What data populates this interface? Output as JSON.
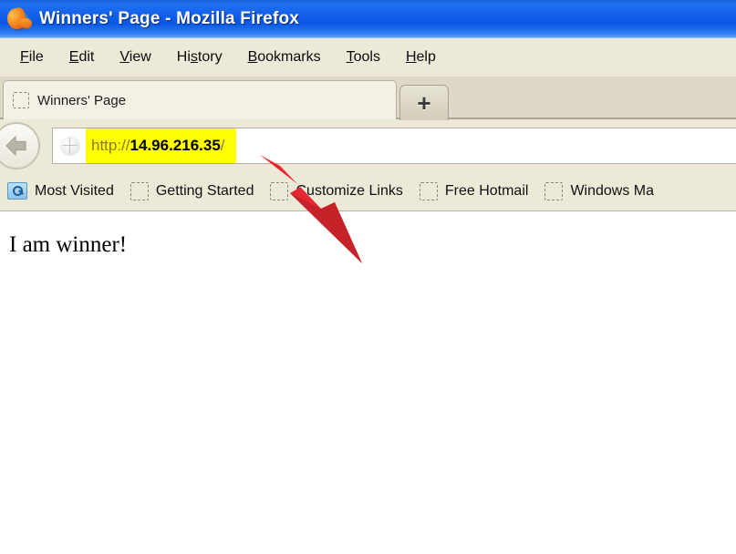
{
  "window": {
    "title": "Winners' Page - Mozilla Firefox",
    "logo_icon": "firefox-logo-icon"
  },
  "menu": {
    "items": [
      {
        "label": "File",
        "accel": "F"
      },
      {
        "label": "Edit",
        "accel": "E"
      },
      {
        "label": "View",
        "accel": "V"
      },
      {
        "label": "History",
        "accel": "s"
      },
      {
        "label": "Bookmarks",
        "accel": "B"
      },
      {
        "label": "Tools",
        "accel": "T"
      },
      {
        "label": "Help",
        "accel": "H"
      }
    ]
  },
  "tabs": {
    "active": {
      "label": "Winners' Page",
      "favicon_icon": "blank-favicon-icon"
    },
    "new_tab_label": "+"
  },
  "navigation": {
    "back_icon": "back-arrow-icon",
    "site_favicon_icon": "globe-icon",
    "url": {
      "scheme": "http://",
      "host": "14.96.216.35",
      "path": "/",
      "full": "http://14.96.216.35/",
      "highlight_color": "#ffff00"
    }
  },
  "bookmarks": {
    "items": [
      {
        "label": "Most Visited",
        "icon": "most-visited-folder-icon"
      },
      {
        "label": "Getting Started",
        "icon": "blank-favicon-icon"
      },
      {
        "label": "Customize Links",
        "icon": "blank-favicon-icon"
      },
      {
        "label": "Free Hotmail",
        "icon": "blank-favicon-icon"
      },
      {
        "label": "Windows Ma",
        "icon": "blank-favicon-icon"
      }
    ]
  },
  "page": {
    "heading": "I am winner!"
  },
  "annotation": {
    "arrow_color": "#e8262f",
    "arrow_tail_color": "#b9202a"
  },
  "colors": {
    "titlebar_blue": "#0f5ce8",
    "chrome_beige": "#ece9d8",
    "highlight_yellow": "#ffff00",
    "arrow_red": "#e8262f"
  }
}
